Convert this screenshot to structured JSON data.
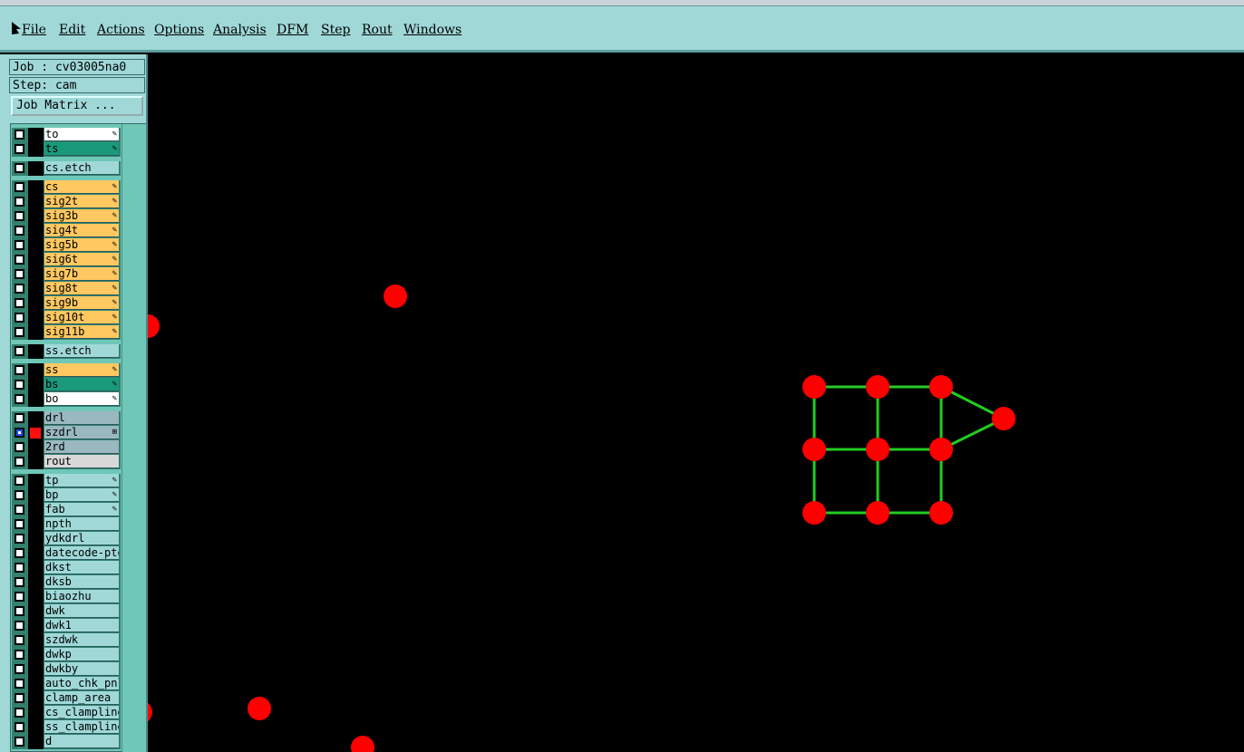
{
  "menubar": {
    "items": [
      "File",
      "Edit",
      "Actions",
      "Options",
      "Analysis",
      "DFM",
      "Step",
      "Rout",
      "Windows"
    ]
  },
  "panel": {
    "job": "Job : cv03005na0",
    "step": "Step: cam",
    "job_matrix_label": "Job Matrix ..."
  },
  "layers": [
    {
      "name": "to",
      "color": "#ffffff",
      "badge": "edit"
    },
    {
      "name": "ts",
      "color": "#1a9a7a",
      "badge": "edit"
    },
    {
      "name": "cs.etch",
      "color": "#a0d8d8",
      "badge": ""
    },
    {
      "name": "cs",
      "color": "#ffc860",
      "badge": "edit"
    },
    {
      "name": "sig2t",
      "color": "#ffc860",
      "badge": "edit"
    },
    {
      "name": "sig3b",
      "color": "#ffc860",
      "badge": "edit"
    },
    {
      "name": "sig4t",
      "color": "#ffc860",
      "badge": "edit"
    },
    {
      "name": "sig5b",
      "color": "#ffc860",
      "badge": "edit"
    },
    {
      "name": "sig6t",
      "color": "#ffc860",
      "badge": "edit"
    },
    {
      "name": "sig7b",
      "color": "#ffc860",
      "badge": "edit"
    },
    {
      "name": "sig8t",
      "color": "#ffc860",
      "badge": "edit"
    },
    {
      "name": "sig9b",
      "color": "#ffc860",
      "badge": "edit"
    },
    {
      "name": "sig10t",
      "color": "#ffc860",
      "badge": "edit"
    },
    {
      "name": "sig11b",
      "color": "#ffc860",
      "badge": "edit"
    },
    {
      "name": "ss.etch",
      "color": "#a0d8d8",
      "badge": ""
    },
    {
      "name": "ss",
      "color": "#ffc860",
      "badge": "edit"
    },
    {
      "name": "bs",
      "color": "#1a9a7a",
      "badge": "edit"
    },
    {
      "name": "bo",
      "color": "#ffffff",
      "badge": "edit"
    },
    {
      "name": "drl",
      "color": "#9ab8c0",
      "badge": ""
    },
    {
      "name": "szdrl",
      "color": "#9ab8c0",
      "badge": "span",
      "checked": true,
      "swatch": "#ff1010"
    },
    {
      "name": "2rd",
      "color": "#9ab8c0",
      "badge": ""
    },
    {
      "name": "rout",
      "color": "#d8d8d8",
      "badge": ""
    },
    {
      "name": "tp",
      "color": "#a0d8d8",
      "badge": "edit"
    },
    {
      "name": "bp",
      "color": "#a0d8d8",
      "badge": "edit"
    },
    {
      "name": "fab",
      "color": "#a0d8d8",
      "badge": "edit"
    },
    {
      "name": "npth",
      "color": "#a0d8d8",
      "badge": ""
    },
    {
      "name": "ydkdrl",
      "color": "#a0d8d8",
      "badge": ""
    },
    {
      "name": "datecode-pte",
      "color": "#a0d8d8",
      "badge": ""
    },
    {
      "name": "dkst",
      "color": "#a0d8d8",
      "badge": ""
    },
    {
      "name": "dksb",
      "color": "#a0d8d8",
      "badge": ""
    },
    {
      "name": "biaozhu",
      "color": "#a0d8d8",
      "badge": ""
    },
    {
      "name": "dwk",
      "color": "#a0d8d8",
      "badge": ""
    },
    {
      "name": "dwk1",
      "color": "#a0d8d8",
      "badge": ""
    },
    {
      "name": "szdwk",
      "color": "#a0d8d8",
      "badge": ""
    },
    {
      "name": "dwkp",
      "color": "#a0d8d8",
      "badge": ""
    },
    {
      "name": "dwkby",
      "color": "#a0d8d8",
      "badge": ""
    },
    {
      "name": "auto_chk_pnl",
      "color": "#a0d8d8",
      "badge": ""
    },
    {
      "name": "clamp_area",
      "color": "#a0d8d8",
      "badge": ""
    },
    {
      "name": "cs_clampline",
      "color": "#a0d8d8",
      "badge": ""
    },
    {
      "name": "ss_clampline",
      "color": "#a0d8d8",
      "badge": ""
    },
    {
      "name": "d",
      "color": "#a0d8d8",
      "badge": ""
    }
  ],
  "colors": {
    "menubar": "#a0d8d8",
    "canvas": "#000000",
    "pad": "#ff0000",
    "trace": "#22cc22"
  },
  "icons": {
    "cursor": "arrow-cursor-icon",
    "edit_badge": "pencil-icon",
    "span_badge": "grid-icon"
  }
}
